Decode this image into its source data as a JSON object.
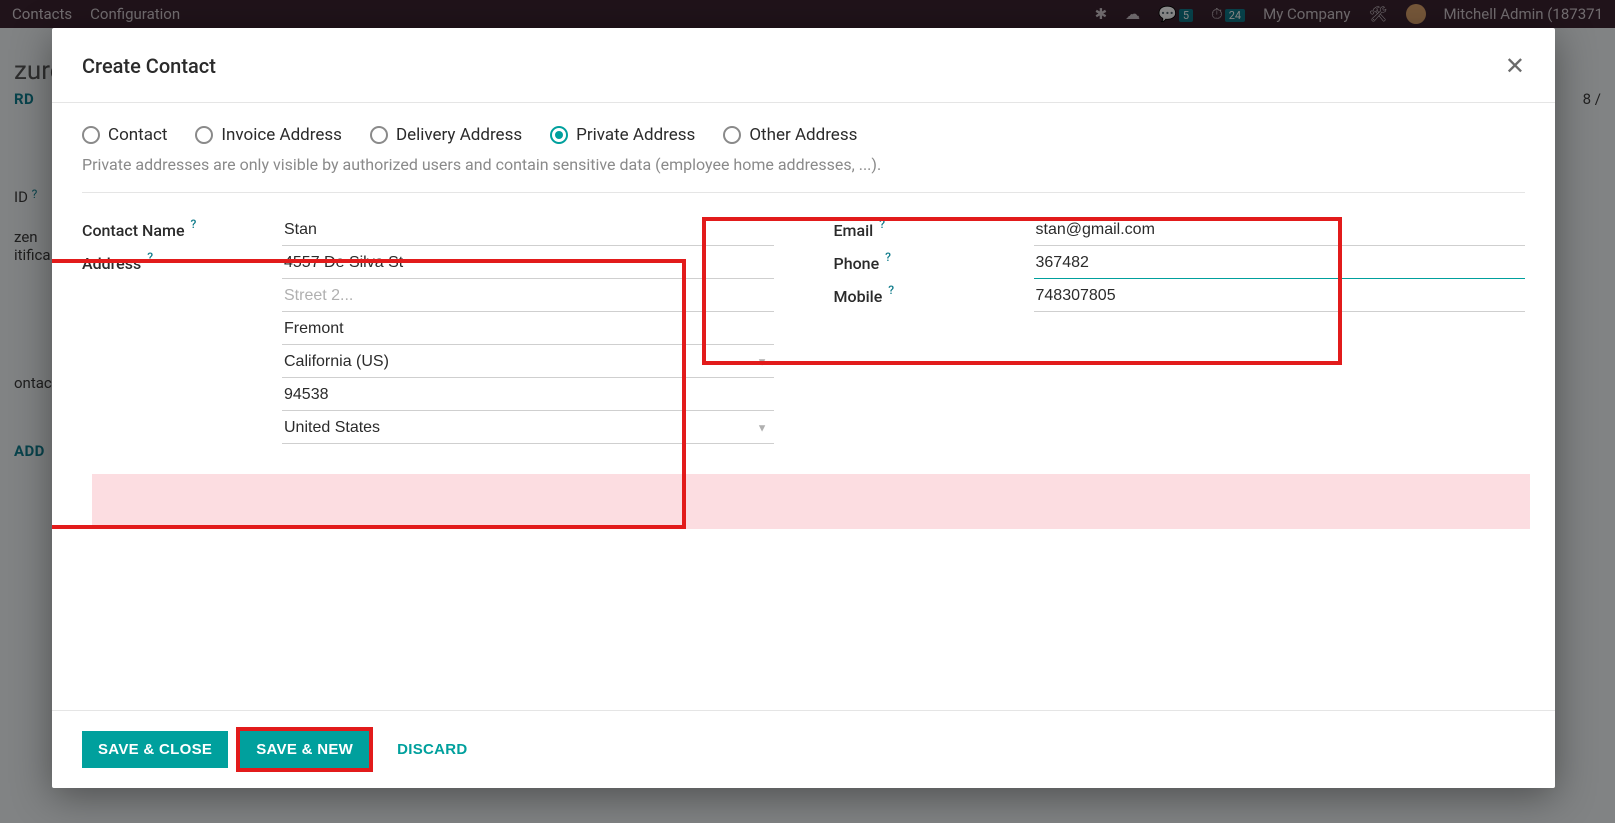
{
  "topbar": {
    "menu_contacts": "Contacts",
    "menu_config": "Configuration",
    "msg_count": "5",
    "clock_count": "24",
    "company": "My Company",
    "user": "Mitchell Admin (187371"
  },
  "background": {
    "title_frag": "zure",
    "discard": "RD",
    "pager": "8 /",
    "id_label": "ID",
    "row1": "zen",
    "row2": "itifica",
    "row3": "ontac",
    "add_label": "ADD"
  },
  "modal": {
    "title": "Create Contact",
    "radios": {
      "contact": "Contact",
      "invoice": "Invoice Address",
      "delivery": "Delivery Address",
      "private": "Private Address",
      "other": "Other Address"
    },
    "helper": "Private addresses are only visible by authorized users and contain sensitive data (employee home addresses, ...).",
    "labels": {
      "contact_name": "Contact Name",
      "address": "Address",
      "email": "Email",
      "phone": "Phone",
      "mobile": "Mobile"
    },
    "placeholders": {
      "street2": "Street 2..."
    },
    "values": {
      "name": "Stan",
      "street": "4557 De Silva St",
      "street2": "",
      "city": "Fremont",
      "state": "California (US)",
      "zip": "94538",
      "country": "United States",
      "email": "stan@gmail.com",
      "phone": "367482",
      "mobile": "748307805"
    },
    "buttons": {
      "save_close": "SAVE & CLOSE",
      "save_new": "SAVE & NEW",
      "discard": "DISCARD"
    }
  }
}
